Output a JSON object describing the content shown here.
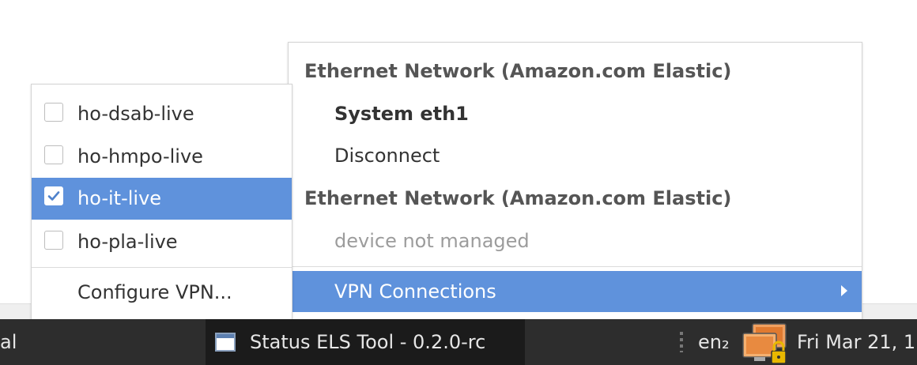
{
  "colors": {
    "highlight": "#5f92dc",
    "taskbar": "#2d2d2d"
  },
  "network_menu": {
    "items": [
      {
        "label": "Ethernet Network (Amazon.com Elastic)"
      },
      {
        "label": "System eth1"
      },
      {
        "label": "Disconnect"
      },
      {
        "label": "Ethernet Network (Amazon.com Elastic)"
      },
      {
        "label": "device not managed"
      },
      {
        "label": "VPN Connections",
        "icon": "chevron-right-icon",
        "highlighted": true
      }
    ]
  },
  "vpn_menu": {
    "items": [
      {
        "label": "ho-dsab-live",
        "checked": false
      },
      {
        "label": "ho-hmpo-live",
        "checked": false
      },
      {
        "label": "ho-it-live",
        "checked": true
      },
      {
        "label": "ho-pla-live",
        "checked": false
      },
      {
        "label": "Configure VPN..."
      }
    ]
  },
  "taskbar": {
    "left_text": "al",
    "task_title": "Status ELS Tool - 0.2.0-rc",
    "keyboard_layout": "en₂",
    "clock": "Fri Mar 21, 1",
    "network_icon": "network-lock-icon",
    "task_icon": "window-icon"
  }
}
